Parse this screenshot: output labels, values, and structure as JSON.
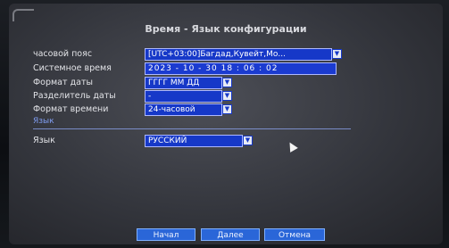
{
  "window": {
    "title": "Время - Язык конфигурации"
  },
  "form": {
    "timezone": {
      "label": "часовой пояс",
      "value": "[UTC+03:00]Багдад,Кувейт,Мо..."
    },
    "system_time": {
      "label": "Системное время",
      "value": "2023 - 10 - 30   18 : 06 : 02"
    },
    "date_format": {
      "label": "Формат даты",
      "value": "ГГГГ ММ ДД"
    },
    "date_separator": {
      "label": "Разделитель даты",
      "value": "-"
    },
    "time_format": {
      "label": "Формат времени",
      "value": "24-часовой"
    }
  },
  "language_section": {
    "header": "Язык",
    "label": "Язык",
    "value": "РУССКИЙ"
  },
  "buttons": {
    "default_label": "Начал",
    "next_label": "Далее",
    "cancel_label": "Отмена"
  },
  "icons": {
    "dropdown": "chevron-down-icon",
    "cursor": "mouse-pointer-icon"
  },
  "colors": {
    "field_blue": "#1638c8",
    "button_blue": "#2a66d8",
    "section_blue": "#7f9cf0"
  }
}
